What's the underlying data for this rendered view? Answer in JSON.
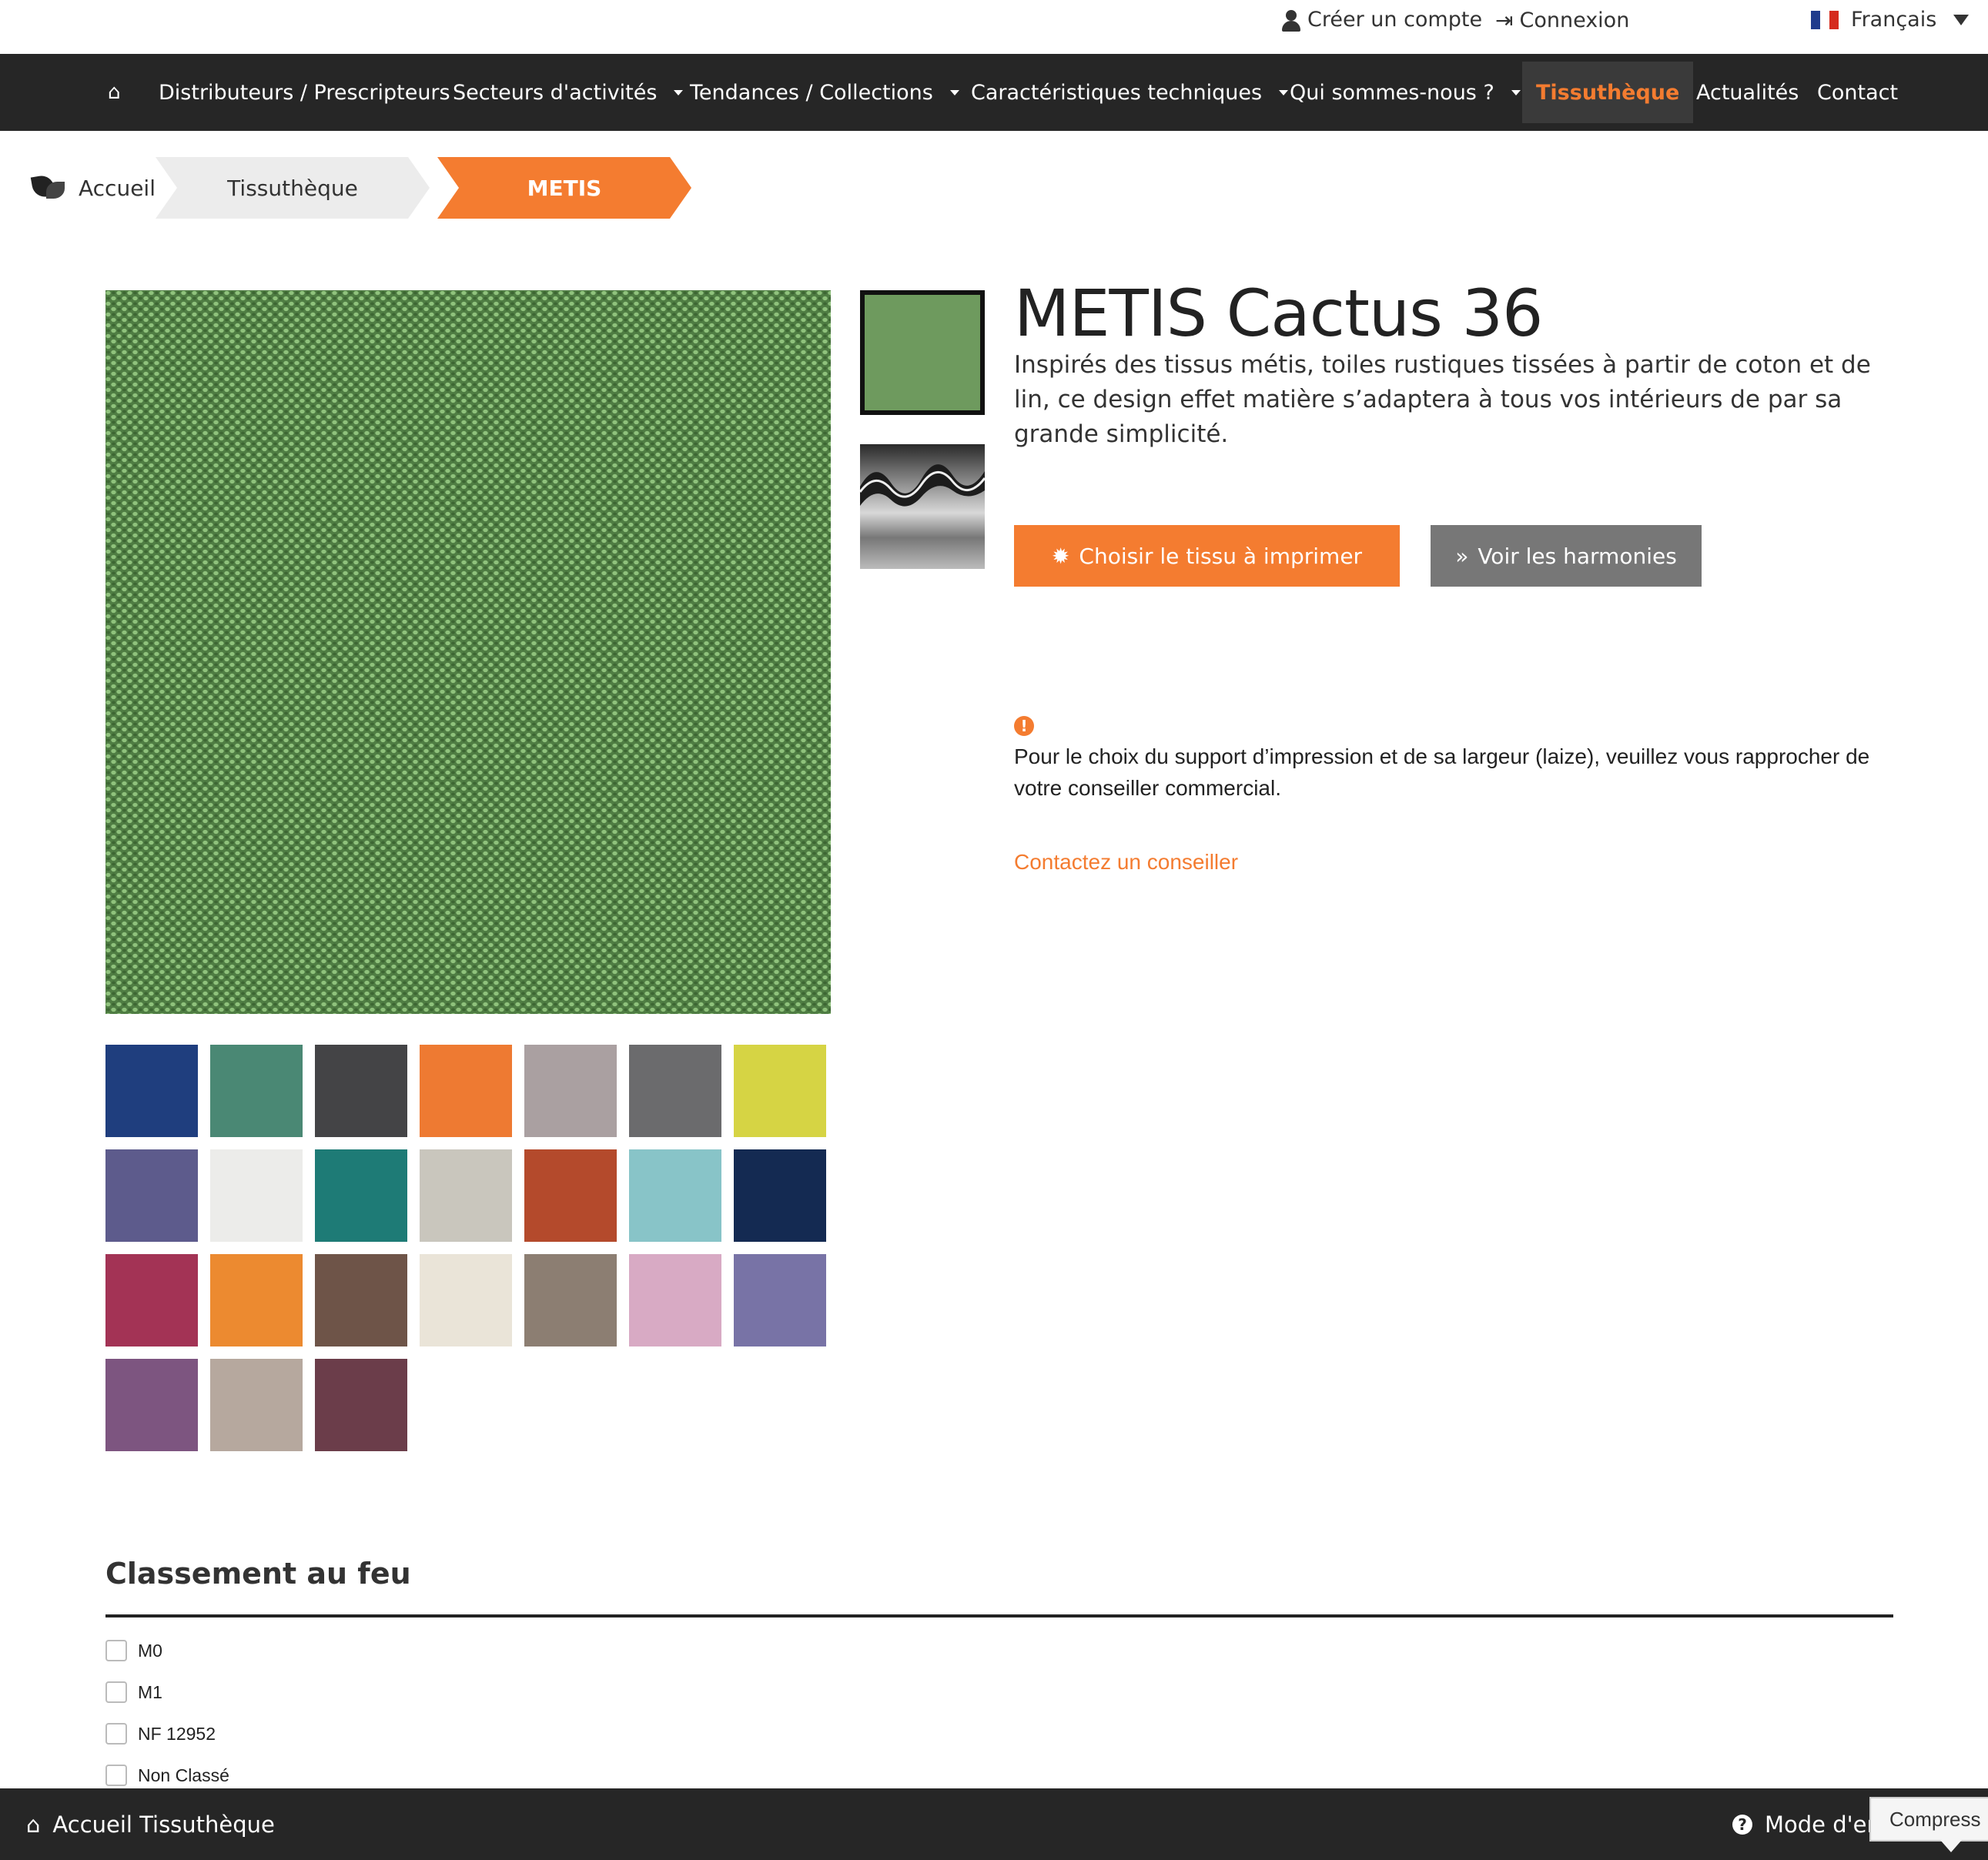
{
  "topbar": {
    "create_account": "Créer un compte",
    "login": "Connexion",
    "language": "Français"
  },
  "nav": {
    "items": [
      {
        "label": "Distributeurs / Prescripteurs"
      },
      {
        "label": "Secteurs d'activités"
      },
      {
        "label": "Tendances / Collections"
      },
      {
        "label": "Caractéristiques techniques"
      },
      {
        "label": "Qui sommes-nous ?"
      },
      {
        "label": "Tissuthèque"
      },
      {
        "label": "Actualités"
      },
      {
        "label": "Contact"
      }
    ],
    "active": "Tissuthèque"
  },
  "breadcrumb": {
    "home": "Accueil",
    "section": "Tissuthèque",
    "current": "METIS"
  },
  "product": {
    "title": "METIS Cactus 36",
    "description": "Inspirés des tissus métis, toiles rustiques tissées à partir de coton et de lin, ce design effet matière s’adaptera à tous vos intérieurs de par sa grande simplicité.",
    "choose_button": "Choisir le tissu à imprimer",
    "harmonies_button": "Voir les harmonies",
    "notice": "Pour le choix du support d’impression et de sa largeur (laize), veuillez vous rapprocher de votre conseiller commercial.",
    "contact_link": "Contactez un conseiller",
    "main_color": "#6e9a5e"
  },
  "swatches": [
    "#1f3e7e",
    "#4a8874",
    "#444446",
    "#ee7a32",
    "#aaa0a1",
    "#6b6b6d",
    "#d6d444",
    "#5d5b8c",
    "#ececea",
    "#1e7b76",
    "#c9c6bd",
    "#b44a2c",
    "#88c4c8",
    "#142a52",
    "#a33355",
    "#ec8a30",
    "#6e5448",
    "#eae4d8",
    "#8c7e72",
    "#d8aac4",
    "#7873a6",
    "#7d5580",
    "#b6a89e",
    "#6b3d4a"
  ],
  "fire_rating": {
    "title": "Classement au feu",
    "options": [
      "M0",
      "M1",
      "NF 12952",
      "Non Classé"
    ]
  },
  "footer": {
    "home_link": "Accueil Tissuthèque",
    "mode_label": "Mode d'em",
    "tooltip": "Compress"
  }
}
